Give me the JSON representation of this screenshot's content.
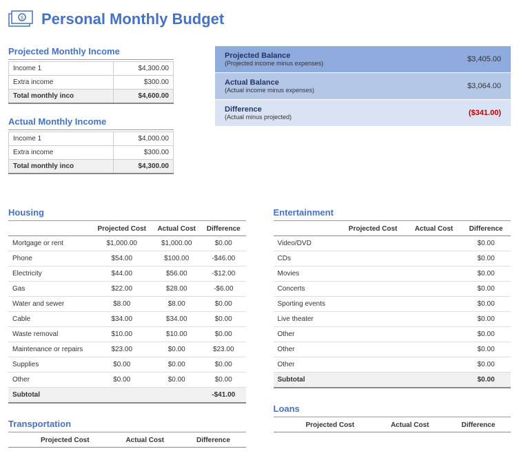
{
  "title": "Personal Monthly Budget",
  "projected_income": {
    "title": "Projected Monthly Income",
    "rows": [
      {
        "label": "Income 1",
        "value": "$4,300.00"
      },
      {
        "label": "Extra income",
        "value": "$300.00"
      }
    ],
    "total_label": "Total monthly inco",
    "total_value": "$4,600.00"
  },
  "actual_income": {
    "title": "Actual Monthly Income",
    "rows": [
      {
        "label": "Income 1",
        "value": "$4,000.00"
      },
      {
        "label": "Extra income",
        "value": "$300.00"
      }
    ],
    "total_label": "Total monthly inco",
    "total_value": "$4,300.00"
  },
  "summary": {
    "projected": {
      "label": "Projected Balance",
      "sub": "(Projected income minus expenses)",
      "value": "$3,405.00"
    },
    "actual": {
      "label": "Actual Balance",
      "sub": "(Actual income minus expenses)",
      "value": "$3,064.00"
    },
    "difference": {
      "label": "Difference",
      "sub": "(Actual minus projected)",
      "value": "($341.00)"
    }
  },
  "col_headers": {
    "proj": "Projected Cost",
    "act": "Actual Cost",
    "diff": "Difference"
  },
  "subtotal_label": "Subtotal",
  "housing": {
    "title": "Housing",
    "rows": [
      {
        "label": "Mortgage or rent",
        "proj": "$1,000.00",
        "act": "$1,000.00",
        "diff": "$0.00"
      },
      {
        "label": "Phone",
        "proj": "$54.00",
        "act": "$100.00",
        "diff": "-$46.00"
      },
      {
        "label": "Electricity",
        "proj": "$44.00",
        "act": "$56.00",
        "diff": "-$12.00"
      },
      {
        "label": "Gas",
        "proj": "$22.00",
        "act": "$28.00",
        "diff": "-$6.00"
      },
      {
        "label": "Water and sewer",
        "proj": "$8.00",
        "act": "$8.00",
        "diff": "$0.00"
      },
      {
        "label": "Cable",
        "proj": "$34.00",
        "act": "$34.00",
        "diff": "$0.00"
      },
      {
        "label": "Waste removal",
        "proj": "$10.00",
        "act": "$10.00",
        "diff": "$0.00"
      },
      {
        "label": "Maintenance or repairs",
        "proj": "$23.00",
        "act": "$0.00",
        "diff": "$23.00"
      },
      {
        "label": "Supplies",
        "proj": "$0.00",
        "act": "$0.00",
        "diff": "$0.00"
      },
      {
        "label": "Other",
        "proj": "$0.00",
        "act": "$0.00",
        "diff": "$0.00"
      }
    ],
    "subtotal_diff": "-$41.00"
  },
  "entertainment": {
    "title": "Entertainment",
    "rows": [
      {
        "label": "Video/DVD",
        "proj": "",
        "act": "",
        "diff": "$0.00"
      },
      {
        "label": "CDs",
        "proj": "",
        "act": "",
        "diff": "$0.00"
      },
      {
        "label": "Movies",
        "proj": "",
        "act": "",
        "diff": "$0.00"
      },
      {
        "label": "Concerts",
        "proj": "",
        "act": "",
        "diff": "$0.00"
      },
      {
        "label": "Sporting events",
        "proj": "",
        "act": "",
        "diff": "$0.00"
      },
      {
        "label": "Live theater",
        "proj": "",
        "act": "",
        "diff": "$0.00"
      },
      {
        "label": "Other",
        "proj": "",
        "act": "",
        "diff": "$0.00"
      },
      {
        "label": "Other",
        "proj": "",
        "act": "",
        "diff": "$0.00"
      },
      {
        "label": "Other",
        "proj": "",
        "act": "",
        "diff": "$0.00"
      }
    ],
    "subtotal_diff": "$0.00"
  },
  "transportation": {
    "title": "Transportation"
  },
  "loans": {
    "title": "Loans"
  }
}
